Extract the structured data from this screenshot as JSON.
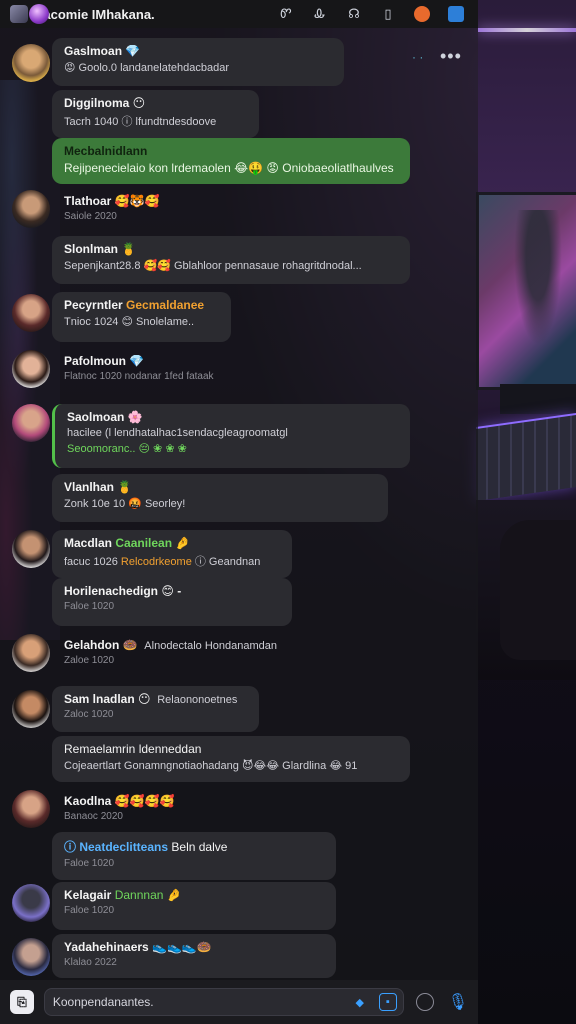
{
  "window": {
    "title": "Dacomie IMhakana.",
    "toolbar": [
      "Ꮫ",
      "Ꮂ",
      "☊",
      "▯"
    ]
  },
  "messages": [
    {
      "name": "Gaslmoan 💎",
      "text": "😡 Goolo.0 landanelatehdacbadar",
      "meta": ""
    },
    {
      "name": "Diggilnoma 😶",
      "text": "Tacrh 1040 ⓘ lfundtndesdoove",
      "meta": ""
    },
    {
      "name": "Mecbalnidlann",
      "text": "Rejipenecielaio kon lrdemaolen 😂🤑 😡 Oniobaeoliatlhaulves",
      "meta": ""
    },
    {
      "name": "Tlathoar 🥰🐯🥰",
      "text": "",
      "meta": "Saiole 2020"
    },
    {
      "name": "Slonlman 🍍",
      "text": "Sepenjkant28.8 🥰🥰 Gblahloor pennasaue rohagritdnodal...",
      "meta": ""
    },
    {
      "name": "Pecyrntler",
      "highlight": "Gecmaldanee",
      "text2": "Tnioc 1024 😊 Snolelame..",
      "meta": ""
    },
    {
      "name": "Pafolmoun 💎",
      "text": "",
      "meta": "Flatnoc 1020 nodanar 1fed fataak"
    },
    {
      "name": "Saolmoan 🌸",
      "text": "hacilee (l lendhatalhac1sendacgleagroomatgl",
      "highlight": "Seoomoranc.. 😔 ❀ ❀ ❀",
      "meta": ""
    },
    {
      "name": "Vlanlhan 🍍",
      "text": "Zonk 10e 10 🤬 Seorley!",
      "meta": ""
    },
    {
      "name": "Macdlan",
      "highlight": "Caanilean 🤌",
      "text2": "facuc 1026",
      "highlight2": "Relcodrkeome",
      "text3": "ⓘ Geandnan",
      "meta": ""
    },
    {
      "name": "Horilenachedign 😊 -",
      "text": "",
      "meta": "Faloe 1020"
    },
    {
      "name": "Gelahdon 🍩",
      "text": "Alnodectalo Hondanamdan",
      "meta": "Zaloe 1020"
    },
    {
      "name": "Sam lnadlan 😶",
      "text": "Relaononoetnes",
      "meta": "Zaloc 1020"
    },
    {
      "name": "Remaelamrin ldenneddan",
      "text": "Cojeaertlart Gonamngnotiaohadang 😈😂😂 Glardlina 😂 91",
      "meta": ""
    },
    {
      "name": "Kaodlna 🥰🥰🥰🥰",
      "text": "",
      "meta": "Banaoc 2020"
    },
    {
      "name": "",
      "highlight": "ⓘ Neatdeclitteans",
      "text": "Beln dalve",
      "meta": "Faloe 1020"
    },
    {
      "name": "Kelagair",
      "highlight": "Dannnan 🤌",
      "text": "",
      "meta": "Faloe 1020"
    },
    {
      "name": "Yadahehinaers 👟👟👟🍩",
      "text": "",
      "meta": "Klalao 2022"
    }
  ],
  "composer": {
    "placeholder": "Koonpendanantes."
  }
}
